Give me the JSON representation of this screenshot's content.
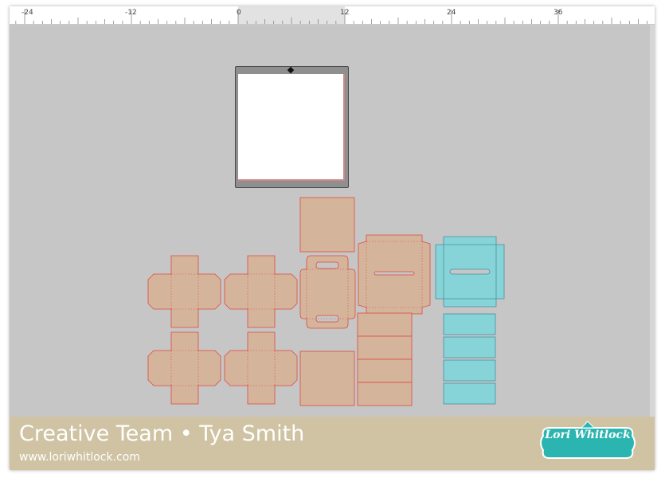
{
  "ruler": {
    "labels": [
      "-24",
      "-12",
      "0",
      "12",
      "24",
      "36"
    ]
  },
  "footer": {
    "title": "Creative Team • Tya Smith",
    "url": "www.loriwhitlock.com",
    "logo_text": "Lori Whitlock"
  },
  "colors": {
    "canvas_background": "#c6c6c6",
    "kraft_piece_fill": "#d4b59c",
    "cut_line": "#e0483c",
    "blue_piece_fill": "#86d3d8",
    "blue_piece_line": "#4a8fa0",
    "footer_background": "#cfc3a3",
    "logo_teal": "#2bb5b0"
  },
  "icons": [
    "mat-handle-icon",
    "lori-whitlock-logo-icon"
  ]
}
